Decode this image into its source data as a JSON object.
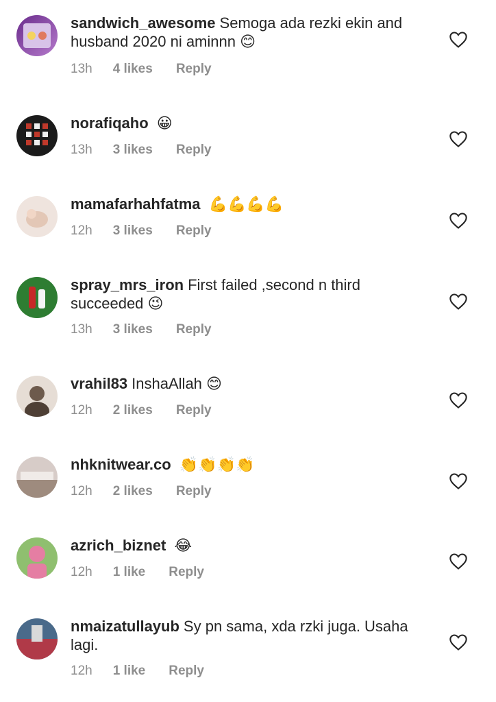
{
  "comments": [
    {
      "username": "sandwich_awesome",
      "text": "Semoga ada rezki ekin and husband 2020 ni aminnn",
      "emoji": "😊",
      "time": "13h",
      "likes": "4 likes",
      "reply": "Reply",
      "avatar_colors": [
        "#6a2c8c",
        "#d8c3e8"
      ]
    },
    {
      "username": "norafiqaho",
      "text": "",
      "emoji": "😀",
      "time": "13h",
      "likes": "3 likes",
      "reply": "Reply",
      "avatar_colors": [
        "#1b1b1b",
        "#c0392b"
      ]
    },
    {
      "username": "mamafarhahfatma",
      "text": "",
      "emoji": "💪💪💪💪",
      "time": "12h",
      "likes": "3 likes",
      "reply": "Reply",
      "avatar_colors": [
        "#e8d9d2",
        "#f3e6e0"
      ]
    },
    {
      "username": "spray_mrs_iron",
      "text": "First failed ,second n third succeeded",
      "emoji": "😉",
      "time": "13h",
      "likes": "3 likes",
      "reply": "Reply",
      "avatar_colors": [
        "#2e7d32",
        "#c62828"
      ]
    },
    {
      "username": "vrahil83",
      "text": "InshaAllah",
      "emoji": "😊",
      "time": "12h",
      "likes": "2 likes",
      "reply": "Reply",
      "avatar_colors": [
        "#6d5a4c",
        "#e6ddd5"
      ]
    },
    {
      "username": "nhknitwear.co",
      "text": "",
      "emoji": "👏👏👏👏",
      "time": "12h",
      "likes": "2 likes",
      "reply": "Reply",
      "avatar_colors": [
        "#9e8b7e",
        "#d7ccc8"
      ]
    },
    {
      "username": "azrich_biznet",
      "text": "",
      "emoji": "😂",
      "time": "12h",
      "likes": "1 like",
      "reply": "Reply",
      "avatar_colors": [
        "#e57ea3",
        "#8fbf6f"
      ]
    },
    {
      "username": "nmaizatullayub",
      "text": "Sy pn sama, xda rzki juga. Usaha lagi.",
      "emoji": "",
      "time": "12h",
      "likes": "1 like",
      "reply": "Reply",
      "avatar_colors": [
        "#4a6a8a",
        "#b03a48"
      ]
    }
  ],
  "colors": {
    "text": "#262626",
    "meta": "#8e8e8e",
    "heart": "#262626"
  },
  "icons": {
    "like": "heart-outline-icon"
  }
}
